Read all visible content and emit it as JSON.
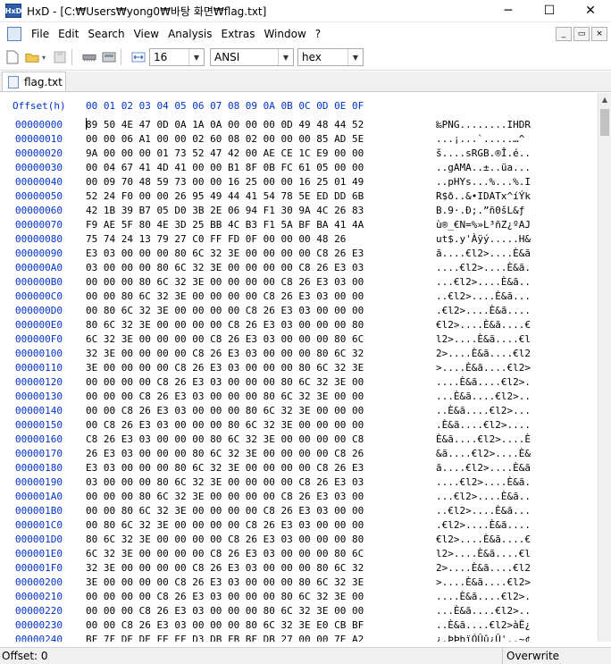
{
  "window": {
    "app_icon_text": "HxD",
    "title": "HxD - [C:₩Users₩yong0₩바탕 화면₩flag.txt]",
    "minimize": "─",
    "maximize": "☐",
    "close": "✕"
  },
  "menu": {
    "items": [
      "File",
      "Edit",
      "Search",
      "View",
      "Analysis",
      "Extras",
      "Window",
      "?"
    ],
    "mdi": [
      "_",
      "▭",
      "×"
    ]
  },
  "toolbar": {
    "bytes_per_row": "16",
    "charset": "ANSI",
    "offset_base": "hex"
  },
  "tabs": [
    {
      "label": "flag.txt"
    }
  ],
  "hex": {
    "header_offset": "Offset(h)",
    "header_cols": "00 01 02 03 04 05 06 07 08 09 0A 0B 0C 0D 0E 0F",
    "rows": [
      {
        "off": "00000000",
        "bytes": "89 50 4E 47 0D 0A 1A 0A 00 00 00 0D 49 48 44 52",
        "text": "‰PNG........IHDR"
      },
      {
        "off": "00000010",
        "bytes": "00 00 06 A1 00 00 02 60 08 02 00 00 00 85 AD 5E",
        "text": "...¡...`.....…­^"
      },
      {
        "off": "00000020",
        "bytes": "9A 00 00 00 01 73 52 47 42 00 AE CE 1C E9 00 00",
        "text": "š....sRGB.®Î.é.."
      },
      {
        "off": "00000030",
        "bytes": "00 04 67 41 4D 41 00 00 B1 8F 0B FC 61 05 00 00",
        "text": "..gAMA..±..üa..."
      },
      {
        "off": "00000040",
        "bytes": "00 09 70 48 59 73 00 00 16 25 00 00 16 25 01 49",
        "text": "..pHYs...%...%.I"
      },
      {
        "off": "00000050",
        "bytes": "52 24 F0 00 00 26 95 49 44 41 54 78 5E ED DD 6B",
        "text": "R$ð..&•IDATx^íÝk"
      },
      {
        "off": "00000060",
        "bytes": "42 1B 39 B7 05 D0 3B 2E 06 94 F1 30 9A 4C 26 83",
        "text": "B.9·.Ð;.”ñ0šL&ƒ"
      },
      {
        "off": "00000070",
        "bytes": "F9 AE 5F 80 4E 3D 25 BB 4C B3 F1 5A BF BA 41 4A",
        "text": "ù®_€N=%»L³ñZ¿ºAJ"
      },
      {
        "off": "00000080",
        "bytes": "75 74 24 13 79 27 C0 FF FD 0F 00 00 00 48 26",
        "text": "ut$.y'Àÿý.....H&"
      },
      {
        "off": "00000090",
        "bytes": "E3 03 00 00 00 80 6C 32 3E 00 00 00 00 C8 26 E3",
        "text": "ã....€l2>....È&ã"
      },
      {
        "off": "000000A0",
        "bytes": "03 00 00 00 80 6C 32 3E 00 00 00 00 C8 26 E3 03",
        "text": "....€l2>....È&ã."
      },
      {
        "off": "000000B0",
        "bytes": "00 00 00 80 6C 32 3E 00 00 00 00 C8 26 E3 03 00",
        "text": "...€l2>....È&ã.."
      },
      {
        "off": "000000C0",
        "bytes": "00 00 80 6C 32 3E 00 00 00 00 C8 26 E3 03 00 00",
        "text": "..€l2>....È&ã..."
      },
      {
        "off": "000000D0",
        "bytes": "00 80 6C 32 3E 00 00 00 00 C8 26 E3 03 00 00 00",
        "text": ".€l2>....È&ã...."
      },
      {
        "off": "000000E0",
        "bytes": "80 6C 32 3E 00 00 00 00 C8 26 E3 03 00 00 00 80",
        "text": "€l2>....È&ã....€"
      },
      {
        "off": "000000F0",
        "bytes": "6C 32 3E 00 00 00 00 C8 26 E3 03 00 00 00 80 6C",
        "text": "l2>....È&ã....€l"
      },
      {
        "off": "00000100",
        "bytes": "32 3E 00 00 00 00 C8 26 E3 03 00 00 00 80 6C 32",
        "text": "2>....È&ã....€l2"
      },
      {
        "off": "00000110",
        "bytes": "3E 00 00 00 00 C8 26 E3 03 00 00 00 80 6C 32 3E",
        "text": ">....È&ã....€l2>"
      },
      {
        "off": "00000120",
        "bytes": "00 00 00 00 C8 26 E3 03 00 00 00 80 6C 32 3E 00",
        "text": "....È&ã....€l2>."
      },
      {
        "off": "00000130",
        "bytes": "00 00 00 C8 26 E3 03 00 00 00 80 6C 32 3E 00 00",
        "text": "...È&ã....€l2>.."
      },
      {
        "off": "00000140",
        "bytes": "00 00 C8 26 E3 03 00 00 00 80 6C 32 3E 00 00 00",
        "text": "..È&ã....€l2>..."
      },
      {
        "off": "00000150",
        "bytes": "00 C8 26 E3 03 00 00 00 80 6C 32 3E 00 00 00 00",
        "text": ".È&ã....€l2>...."
      },
      {
        "off": "00000160",
        "bytes": "C8 26 E3 03 00 00 00 80 6C 32 3E 00 00 00 00 C8",
        "text": "È&ã....€l2>....È"
      },
      {
        "off": "00000170",
        "bytes": "26 E3 03 00 00 00 80 6C 32 3E 00 00 00 00 C8 26",
        "text": "&ã....€l2>....È&"
      },
      {
        "off": "00000180",
        "bytes": "E3 03 00 00 00 80 6C 32 3E 00 00 00 00 C8 26 E3",
        "text": "ã....€l2>....È&ã"
      },
      {
        "off": "00000190",
        "bytes": "03 00 00 00 80 6C 32 3E 00 00 00 00 C8 26 E3 03",
        "text": "....€l2>....È&ã."
      },
      {
        "off": "000001A0",
        "bytes": "00 00 00 80 6C 32 3E 00 00 00 00 C8 26 E3 03 00",
        "text": "...€l2>....È&ã.."
      },
      {
        "off": "000001B0",
        "bytes": "00 00 80 6C 32 3E 00 00 00 00 C8 26 E3 03 00 00",
        "text": "..€l2>....È&ã..."
      },
      {
        "off": "000001C0",
        "bytes": "00 80 6C 32 3E 00 00 00 00 C8 26 E3 03 00 00 00",
        "text": ".€l2>....È&ã...."
      },
      {
        "off": "000001D0",
        "bytes": "80 6C 32 3E 00 00 00 00 C8 26 E3 03 00 00 00 80",
        "text": "€l2>....È&ã....€"
      },
      {
        "off": "000001E0",
        "bytes": "6C 32 3E 00 00 00 00 C8 26 E3 03 00 00 00 80 6C",
        "text": "l2>....È&ã....€l"
      },
      {
        "off": "000001F0",
        "bytes": "32 3E 00 00 00 00 C8 26 E3 03 00 00 00 80 6C 32",
        "text": "2>....È&ã....€l2"
      },
      {
        "off": "00000200",
        "bytes": "3E 00 00 00 00 C8 26 E3 03 00 00 00 80 6C 32 3E",
        "text": ">....È&ã....€l2>"
      },
      {
        "off": "00000210",
        "bytes": "00 00 00 00 C8 26 E3 03 00 00 00 80 6C 32 3E 00",
        "text": "....È&ã....€l2>."
      },
      {
        "off": "00000220",
        "bytes": "00 00 00 C8 26 E3 03 00 00 00 80 6C 32 3E 00 00",
        "text": "...È&ã....€l2>.."
      },
      {
        "off": "00000230",
        "bytes": "00 00 C8 26 E3 03 00 00 00 80 6C 32 3E E0 CB BF",
        "text": "..È&ã....€l2>àË¿"
      },
      {
        "off": "00000240",
        "bytes": "BF 7F DE DE FE EF D3 DB FB BF DB 27 00 00 7E A2",
        "text": "¿.ÞÞþïÓÛû¿Û'..~¢"
      }
    ]
  },
  "status": {
    "offset": "Offset: 0",
    "mode": "Overwrite"
  }
}
